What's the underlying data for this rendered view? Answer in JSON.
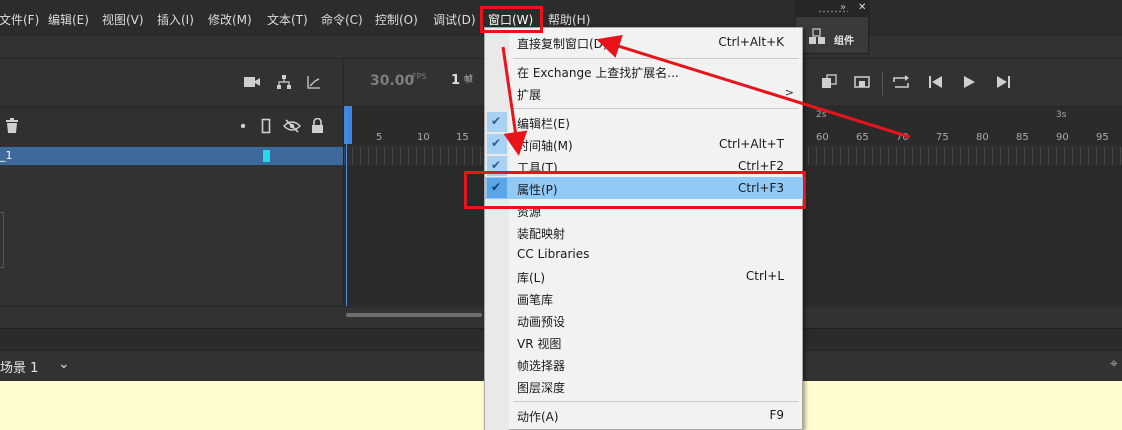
{
  "menubar": {
    "items": [
      {
        "label": "文件(F)"
      },
      {
        "label": "编辑(E)"
      },
      {
        "label": "视图(V)"
      },
      {
        "label": "插入(I)"
      },
      {
        "label": "修改(M)"
      },
      {
        "label": "文本(T)"
      },
      {
        "label": "命令(C)"
      },
      {
        "label": "控制(O)"
      },
      {
        "label": "调试(D)"
      },
      {
        "label": "窗口(W)"
      },
      {
        "label": "帮助(H)"
      }
    ]
  },
  "components_panel": {
    "label": "组件",
    "icon": "components-icon"
  },
  "timeline": {
    "fps_value": "30.00",
    "fps_unit": "FPS",
    "current_frame": "1",
    "frame_unit": "帧",
    "layer_name": "_1",
    "layer_color": "#27d7f0",
    "ruler_numbers": [
      "5",
      "10",
      "15",
      "60",
      "65",
      "70",
      "75",
      "80",
      "85",
      "90",
      "95"
    ],
    "ruler_seconds": [
      "2s",
      "3s"
    ]
  },
  "scene": {
    "label": "场景 1"
  },
  "window_menu": {
    "items": [
      {
        "label": "直接复制窗口(D)",
        "shortcut": "Ctrl+Alt+K",
        "checked": false
      },
      {
        "label": "在 Exchange 上查找扩展名...",
        "shortcut": "",
        "checked": false
      },
      {
        "label": "扩展",
        "shortcut": "",
        "checked": false,
        "submenu": ">"
      },
      {
        "label": "编辑栏(E)",
        "shortcut": "",
        "checked": true
      },
      {
        "label": "时间轴(M)",
        "shortcut": "Ctrl+Alt+T",
        "checked": true
      },
      {
        "label": "工具(T)",
        "shortcut": "Ctrl+F2",
        "checked": true
      },
      {
        "label": "属性(P)",
        "shortcut": "Ctrl+F3",
        "checked": true,
        "highlighted": true
      },
      {
        "label": "资源",
        "shortcut": "",
        "checked": false
      },
      {
        "label": "装配映射",
        "shortcut": "",
        "checked": false
      },
      {
        "label": "CC Libraries",
        "shortcut": "",
        "checked": false
      },
      {
        "label": "库(L)",
        "shortcut": "Ctrl+L",
        "checked": false
      },
      {
        "label": "画笔库",
        "shortcut": "",
        "checked": false
      },
      {
        "label": "动画预设",
        "shortcut": "",
        "checked": false
      },
      {
        "label": "VR 视图",
        "shortcut": "",
        "checked": false
      },
      {
        "label": "帧选择器",
        "shortcut": "",
        "checked": false
      },
      {
        "label": "图层深度",
        "shortcut": "",
        "checked": false
      },
      {
        "label": "动作(A)",
        "shortcut": "F9",
        "checked": false
      }
    ]
  },
  "colors": {
    "menu_highlight": "#91c9f7",
    "annotation": "#e8141a",
    "stage": "#fffcd0",
    "layer_selected": "#3d6a9b"
  }
}
